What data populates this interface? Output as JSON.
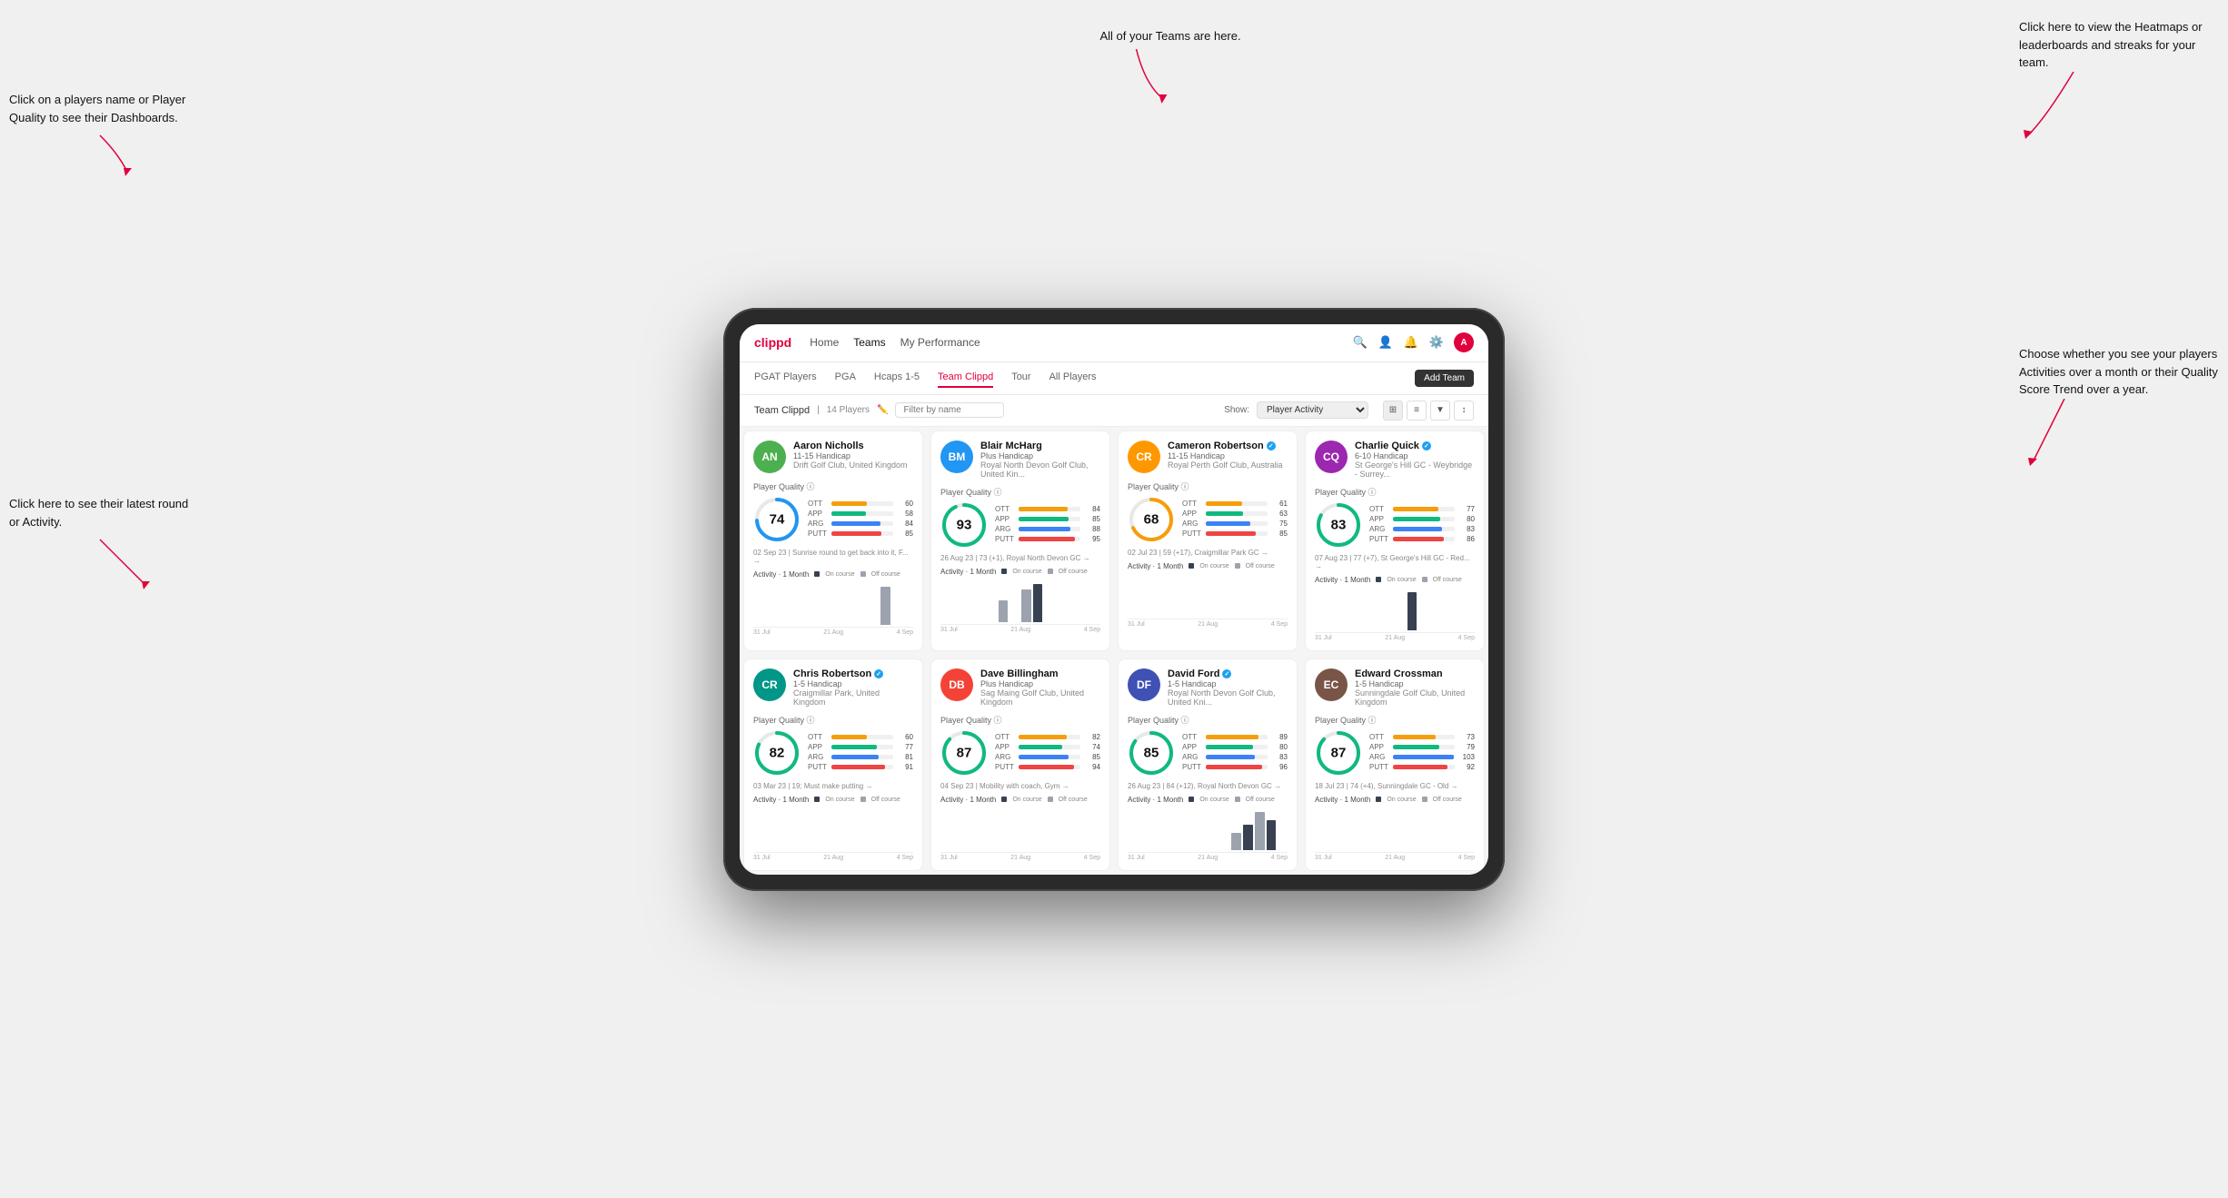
{
  "page": {
    "title": "Clippd - Team Clippd"
  },
  "annotations": {
    "left_top": "Click on a players name or Player Quality to see their Dashboards.",
    "left_bottom": "Click here to see their latest round or Activity.",
    "top_center": "All of your Teams are here.",
    "right_top": "Click here to view the Heatmaps or leaderboards and streaks for your team.",
    "right_bottom": "Choose whether you see your players Activities over a month or their Quality Score Trend over a year."
  },
  "nav": {
    "logo": "clippd",
    "links": [
      "Home",
      "Teams",
      "My Performance"
    ],
    "active_link": "Teams"
  },
  "sub_nav": {
    "links": [
      "PGAT Players",
      "PGA",
      "Hcaps 1-5",
      "Team Clippd",
      "Tour",
      "All Players"
    ],
    "active_link": "Team Clippd",
    "add_team_label": "Add Team"
  },
  "team_header": {
    "title": "Team Clippd",
    "count": "14 Players",
    "search_placeholder": "Filter by name",
    "show_label": "Show:",
    "show_options": [
      "Player Activity",
      "Quality Score Trend"
    ],
    "show_selected": "Player Activity"
  },
  "players": [
    {
      "name": "Aaron Nicholls",
      "handicap": "11-15 Handicap",
      "club": "Drift Golf Club, United Kingdom",
      "avatar_color": "av-green",
      "avatar_initials": "AN",
      "quality_score": 74,
      "circle_color": "#2196F3",
      "stats": [
        {
          "label": "OTT",
          "value": 60,
          "color": "#F59E0B"
        },
        {
          "label": "APP",
          "value": 58,
          "color": "#10B981"
        },
        {
          "label": "ARG",
          "value": 84,
          "color": "#3B82F6"
        },
        {
          "label": "PUTT",
          "value": 85,
          "color": "#EF4444"
        }
      ],
      "latest_round": "02 Sep 23 | Sunrise round to get back into it, F... →",
      "chart_bars": [
        0,
        0,
        0,
        0,
        0,
        0,
        0,
        0,
        0,
        0,
        0,
        15,
        0,
        0
      ],
      "dates": [
        "31 Jul",
        "21 Aug",
        "4 Sep"
      ],
      "verified": false
    },
    {
      "name": "Blair McHarg",
      "handicap": "Plus Handicap",
      "club": "Royal North Devon Golf Club, United Kin...",
      "avatar_color": "av-blue",
      "avatar_initials": "BM",
      "quality_score": 93,
      "circle_color": "#10B981",
      "stats": [
        {
          "label": "OTT",
          "value": 84,
          "color": "#F59E0B"
        },
        {
          "label": "APP",
          "value": 85,
          "color": "#10B981"
        },
        {
          "label": "ARG",
          "value": 88,
          "color": "#3B82F6"
        },
        {
          "label": "PUTT",
          "value": 95,
          "color": "#EF4444"
        }
      ],
      "latest_round": "26 Aug 23 | 73 (+1), Royal North Devon GC →",
      "chart_bars": [
        0,
        0,
        0,
        0,
        0,
        20,
        0,
        30,
        35,
        0,
        0,
        0,
        0,
        0
      ],
      "dates": [
        "31 Jul",
        "21 Aug",
        "4 Sep"
      ],
      "verified": false
    },
    {
      "name": "Cameron Robertson",
      "handicap": "11-15 Handicap",
      "club": "Royal Perth Golf Club, Australia",
      "avatar_color": "av-orange",
      "avatar_initials": "CR",
      "quality_score": 68,
      "circle_color": "#F59E0B",
      "stats": [
        {
          "label": "OTT",
          "value": 61,
          "color": "#F59E0B"
        },
        {
          "label": "APP",
          "value": 63,
          "color": "#10B981"
        },
        {
          "label": "ARG",
          "value": 75,
          "color": "#3B82F6"
        },
        {
          "label": "PUTT",
          "value": 85,
          "color": "#EF4444"
        }
      ],
      "latest_round": "02 Jul 23 | 59 (+17), Craigmillar Park GC →",
      "chart_bars": [
        0,
        0,
        0,
        0,
        0,
        0,
        0,
        0,
        0,
        0,
        0,
        0,
        0,
        0
      ],
      "dates": [
        "31 Jul",
        "21 Aug",
        "4 Sep"
      ],
      "verified": true
    },
    {
      "name": "Charlie Quick",
      "handicap": "6-10 Handicap",
      "club": "St George's Hill GC - Weybridge - Surrey...",
      "avatar_color": "av-purple",
      "avatar_initials": "CQ",
      "quality_score": 83,
      "circle_color": "#10B981",
      "stats": [
        {
          "label": "OTT",
          "value": 77,
          "color": "#F59E0B"
        },
        {
          "label": "APP",
          "value": 80,
          "color": "#10B981"
        },
        {
          "label": "ARG",
          "value": 83,
          "color": "#3B82F6"
        },
        {
          "label": "PUTT",
          "value": 86,
          "color": "#EF4444"
        }
      ],
      "latest_round": "07 Aug 23 | 77 (+7), St George's Hill GC - Red... →",
      "chart_bars": [
        0,
        0,
        0,
        0,
        0,
        0,
        0,
        0,
        12,
        0,
        0,
        0,
        0,
        0
      ],
      "dates": [
        "31 Jul",
        "21 Aug",
        "4 Sep"
      ],
      "verified": true
    },
    {
      "name": "Chris Robertson",
      "handicap": "1-5 Handicap",
      "club": "Craigmillar Park, United Kingdom",
      "avatar_color": "av-teal",
      "avatar_initials": "CR",
      "quality_score": 82,
      "circle_color": "#10B981",
      "stats": [
        {
          "label": "OTT",
          "value": 60,
          "color": "#F59E0B"
        },
        {
          "label": "APP",
          "value": 77,
          "color": "#10B981"
        },
        {
          "label": "ARG",
          "value": 81,
          "color": "#3B82F6"
        },
        {
          "label": "PUTT",
          "value": 91,
          "color": "#EF4444"
        }
      ],
      "latest_round": "03 Mar 23 | 19; Must make putting →",
      "chart_bars": [
        0,
        0,
        0,
        0,
        0,
        0,
        0,
        0,
        0,
        0,
        0,
        0,
        0,
        0
      ],
      "dates": [
        "31 Jul",
        "21 Aug",
        "4 Sep"
      ],
      "verified": true
    },
    {
      "name": "Dave Billingham",
      "handicap": "Plus Handicap",
      "club": "Sag Maing Golf Club, United Kingdom",
      "avatar_color": "av-red",
      "avatar_initials": "DB",
      "quality_score": 87,
      "circle_color": "#10B981",
      "stats": [
        {
          "label": "OTT",
          "value": 82,
          "color": "#F59E0B"
        },
        {
          "label": "APP",
          "value": 74,
          "color": "#10B981"
        },
        {
          "label": "ARG",
          "value": 85,
          "color": "#3B82F6"
        },
        {
          "label": "PUTT",
          "value": 94,
          "color": "#EF4444"
        }
      ],
      "latest_round": "04 Sep 23 | Mobility with coach, Gym →",
      "chart_bars": [
        0,
        0,
        0,
        0,
        0,
        0,
        0,
        0,
        0,
        0,
        0,
        0,
        0,
        0
      ],
      "dates": [
        "31 Jul",
        "21 Aug",
        "4 Sep"
      ],
      "verified": false
    },
    {
      "name": "David Ford",
      "handicap": "1-5 Handicap",
      "club": "Royal North Devon Golf Club, United Kni...",
      "avatar_color": "av-indigo",
      "avatar_initials": "DF",
      "quality_score": 85,
      "circle_color": "#10B981",
      "stats": [
        {
          "label": "OTT",
          "value": 89,
          "color": "#F59E0B"
        },
        {
          "label": "APP",
          "value": 80,
          "color": "#10B981"
        },
        {
          "label": "ARG",
          "value": 83,
          "color": "#3B82F6"
        },
        {
          "label": "PUTT",
          "value": 96,
          "color": "#EF4444"
        }
      ],
      "latest_round": "26 Aug 23 | 84 (+12), Royal North Devon GC →",
      "chart_bars": [
        0,
        0,
        0,
        0,
        0,
        0,
        0,
        0,
        0,
        20,
        30,
        45,
        35,
        0
      ],
      "dates": [
        "31 Jul",
        "21 Aug",
        "4 Sep"
      ],
      "verified": true
    },
    {
      "name": "Edward Crossman",
      "handicap": "1-5 Handicap",
      "club": "Sunningdale Golf Club, United Kingdom",
      "avatar_color": "av-brown",
      "avatar_initials": "EC",
      "quality_score": 87,
      "circle_color": "#10B981",
      "stats": [
        {
          "label": "OTT",
          "value": 73,
          "color": "#F59E0B"
        },
        {
          "label": "APP",
          "value": 79,
          "color": "#10B981"
        },
        {
          "label": "ARG",
          "value": 103,
          "color": "#3B82F6"
        },
        {
          "label": "PUTT",
          "value": 92,
          "color": "#EF4444"
        }
      ],
      "latest_round": "18 Jul 23 | 74 (+4), Sunningdale GC - Old →",
      "chart_bars": [
        0,
        0,
        0,
        0,
        0,
        0,
        0,
        0,
        0,
        0,
        0,
        0,
        0,
        0
      ],
      "dates": [
        "31 Jul",
        "21 Aug",
        "4 Sep"
      ],
      "verified": false
    }
  ],
  "chart": {
    "oncourse_color": "#374151",
    "offcourse_color": "#9CA3AF",
    "activity_label": "Activity · 1 Month",
    "oncourse_label": "On course",
    "offcourse_label": "Off course"
  }
}
